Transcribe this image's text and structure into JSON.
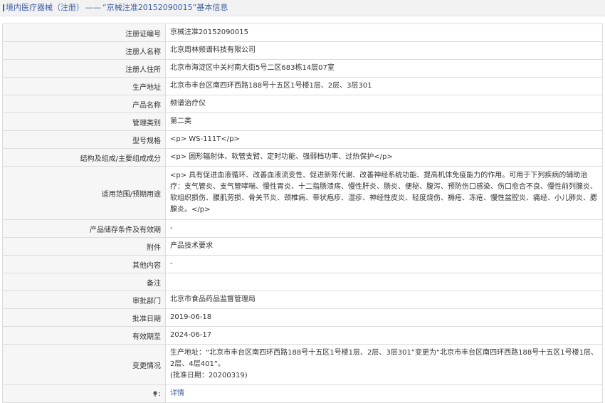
{
  "header": {
    "category": "境内医疗器械（注册）",
    "separator": "——",
    "title": "“京械注准20152090015”基本信息"
  },
  "rows": [
    {
      "label": "注册证编号",
      "value": "京械注准20152090015"
    },
    {
      "label": "注册人名称",
      "value": "北京周林频谱科技有限公司"
    },
    {
      "label": "注册人住所",
      "value": "北京市海淀区中关村南大街5号二区683栋14层07室"
    },
    {
      "label": "生产地址",
      "value": "北京市丰台区南四环西路188号十五区1号楼1层、2层、3层301"
    },
    {
      "label": "产品名称",
      "value": "频谱治疗仪"
    },
    {
      "label": "管理类别",
      "value": "第二类"
    },
    {
      "label": "型号规格",
      "value": "<p> WS-111T</p>"
    },
    {
      "label": "结构及组成/主要组成成分",
      "value": "<p> 圆形辐射体、软管支臂、定时功能、强弱档功率、过热保护</p>"
    },
    {
      "label": "适用范围/预期用途",
      "value": "<p> 具有促进血液循环、改善血液流变性、促进新陈代谢、改善神经系统功能、提高机体免疫能力的作用。可用于下列疾病的辅助治疗：支气管炎、支气管哮喘、慢性胃炎、十二指肠溃疡、慢性肝炎、肠炎、便秘、腹泻、预防伤口感染、伤口愈合不良、慢性前列腺炎、软组织损伤、腰肌劳损、骨关节炎、颈椎病、带状疱疹、湿疹、神经性皮炎、轻度烧伤、褥疮、冻疮、慢性盆腔炎、痛经、小儿肺炎、腮腺炎。</p>"
    },
    {
      "label": "产品储存条件及有效期",
      "value": "-"
    },
    {
      "label": "附件",
      "value": "产品技术要求"
    },
    {
      "label": "其他内容",
      "value": "-"
    },
    {
      "label": "备注",
      "value": ""
    },
    {
      "label": "审批部门",
      "value": "北京市食品药品监督管理局"
    },
    {
      "label": "批准日期",
      "value": "2019-06-18"
    },
    {
      "label": "有效期至",
      "value": "2024-06-17"
    },
    {
      "label": "变更情况",
      "value": "生产地址：“北京市丰台区南四环西路188号十五区1号楼1层、2层、3层301”变更为“北京市丰台区南四环西路188号十五区1号楼1层、2层、4层401”。",
      "value2": "(批准日期：20200319)"
    }
  ],
  "footer_row": {
    "icon": "pin-icon",
    "link_text": "详情"
  },
  "colors": {
    "accent": "#3b5fa8",
    "label_bg": "#f6f6f6",
    "border": "#dcdcdc"
  }
}
